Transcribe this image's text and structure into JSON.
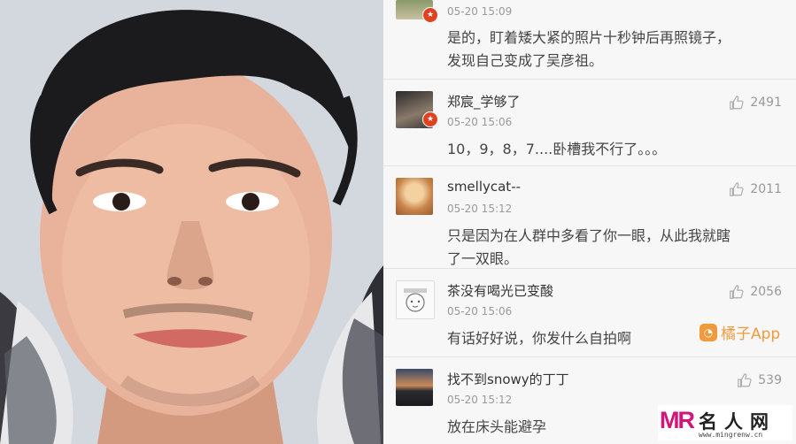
{
  "photo": {
    "alt_icon": "selfie-photo"
  },
  "comments": [
    {
      "avatar_icon": "avatar-icon",
      "time": "05-20 15:09",
      "text_lines": [
        "是的，盯着矮大紧的照片十秒钟后再照镜子，",
        "发现自己变成了吴彦祖。"
      ]
    },
    {
      "avatar_icon": "avatar-icon",
      "name": "郑宸_学够了",
      "likes": "2491",
      "time": "05-20 15:06",
      "text_lines": [
        "10，9，8，7....卧槽我不行了。。。"
      ]
    },
    {
      "avatar_icon": "avatar-icon",
      "name": "smellycat--",
      "likes": "2011",
      "time": "05-20 15:12",
      "text_lines": [
        "只是因为在人群中多看了你一眼，从此我就瞎",
        "了一双眼。"
      ]
    },
    {
      "avatar_icon": "avatar-icon",
      "name": "茶没有喝光已变酸",
      "likes": "2056",
      "time": "05-20 15:06",
      "text_lines": [
        "有话好好说，你发什么自拍啊"
      ]
    },
    {
      "avatar_icon": "avatar-icon",
      "name": "找不到snowy的丁丁",
      "likes": "539",
      "time": "05-20 15:12",
      "text_lines": [
        "放在床头能避孕"
      ]
    }
  ],
  "app_watermark": {
    "label": "橘子App",
    "icon": "orange-app-icon"
  },
  "brand": {
    "logo": "MR",
    "name": "名人网",
    "url": "www.mingrenw.cn"
  },
  "colors": {
    "badge": "#e1411f",
    "brand": "#d4147a",
    "app": "#f08a1c"
  }
}
